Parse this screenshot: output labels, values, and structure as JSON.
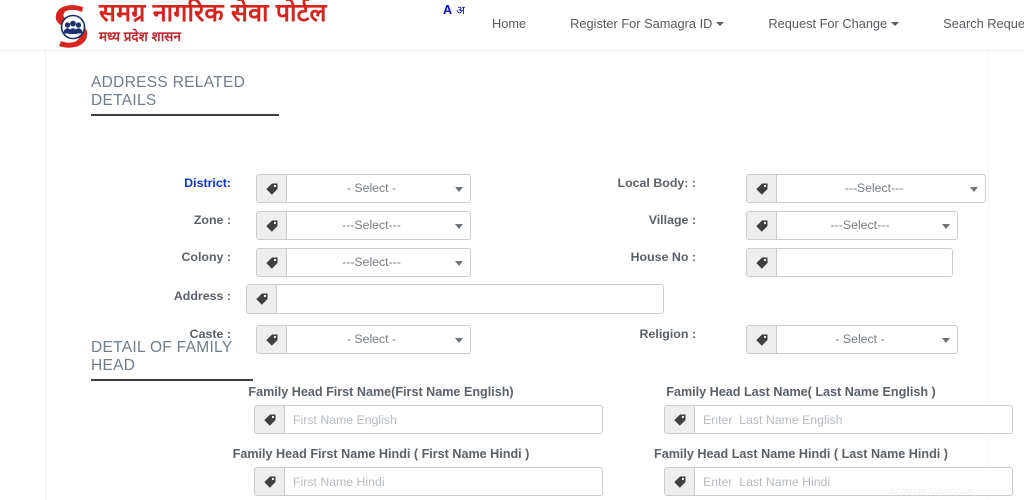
{
  "header": {
    "brand_title_hi": "समग्र नागरिक सेवा पोर्टल",
    "brand_subtitle_hi": "मध्य प्रदेश शासन",
    "lang_en": "A",
    "lang_hi": "अ",
    "nav": [
      {
        "label": "Home",
        "caret": false
      },
      {
        "label": "Register For Samagra ID",
        "caret": true
      },
      {
        "label": "Request For Change",
        "caret": true
      },
      {
        "label": "Search Requests",
        "caret": true
      }
    ]
  },
  "address_section": {
    "heading": "ADDRESS RELATED DETAILS",
    "fields": {
      "district_label": "District:",
      "district_value": "- Select -",
      "local_body_label": "Local Body: :",
      "local_body_value": "---Select---",
      "zone_label": "Zone :",
      "zone_value": "---Select---",
      "village_label": "Village :",
      "village_value": "---Select---",
      "colony_label": "Colony :",
      "colony_value": "---Select---",
      "house_no_label": "House No :",
      "house_no_value": "",
      "address_label": "Address :",
      "address_value": "",
      "caste_label": "Caste :",
      "caste_value": "- Select -",
      "religion_label": "Religion :",
      "religion_value": "- Select -"
    }
  },
  "family_head_section": {
    "heading": "DETAIL OF FAMILY HEAD",
    "first_name_en_title": "Family Head First Name(First Name English)",
    "first_name_en_placeholder": "First Name English",
    "first_name_en_value": "",
    "last_name_en_title": "Family Head Last Name( Last Name English )",
    "last_name_en_placeholder": "Enter  Last Name English",
    "last_name_en_value": "",
    "first_name_hi_title": "Family Head First Name Hindi ( First Name Hindi )",
    "first_name_hi_placeholder": "First Name Hindi",
    "first_name_hi_value": "",
    "last_name_hi_title": "Family Head Last Name Hindi ( Last Name Hindi )",
    "last_name_hi_placeholder": "Enter  Last Name Hindi",
    "last_name_hi_value": ""
  },
  "watermark": {
    "text": "Activate Windows"
  },
  "colors": {
    "brand_red": "#d6251e",
    "required_blue": "#0a35cf",
    "label_gray": "#5a6168",
    "heading_gray": "#6f7d8c",
    "addon_bg": "#eeeeee",
    "border": "#cccccc"
  }
}
